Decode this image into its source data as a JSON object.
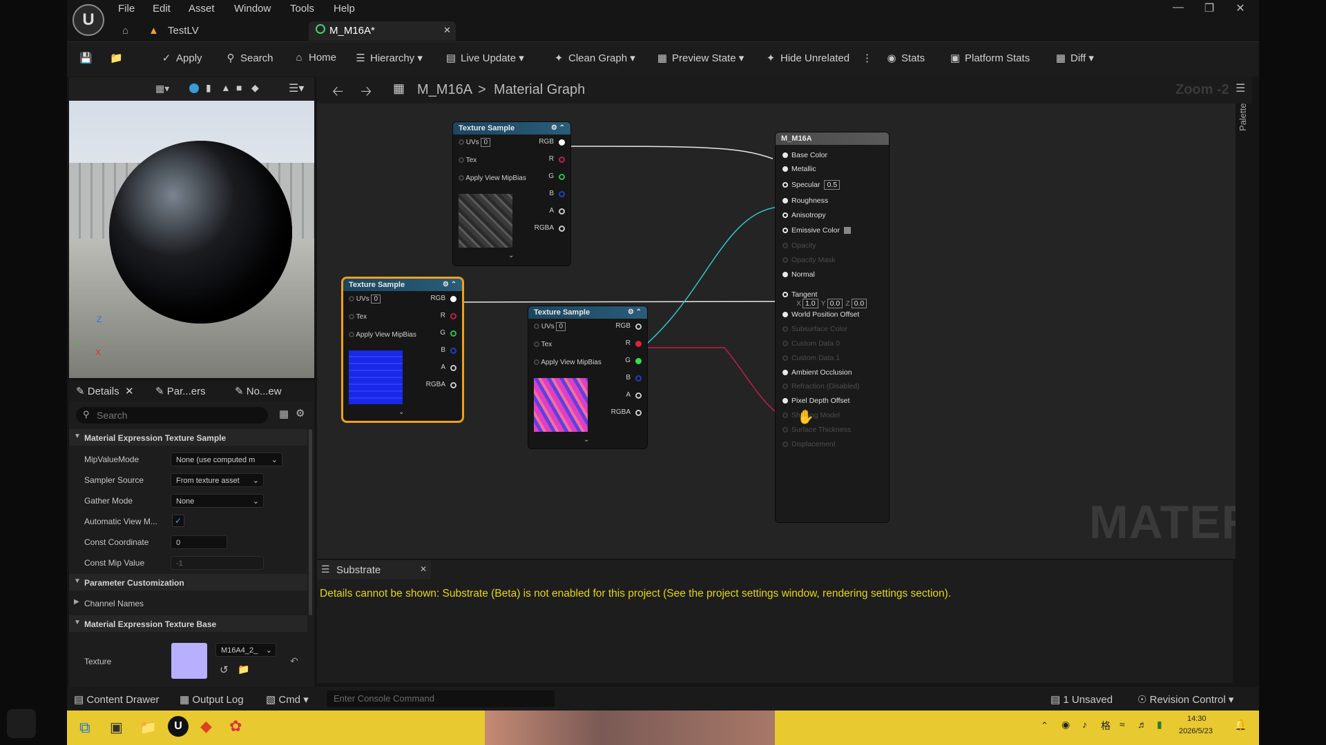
{
  "menu": [
    "File",
    "Edit",
    "Asset",
    "Window",
    "Tools",
    "Help"
  ],
  "tabs": {
    "level": "TestLV",
    "asset": "M_M16A*"
  },
  "toolbar": {
    "apply": "Apply",
    "search": "Search",
    "home": "Home",
    "hierarchy": "Hierarchy",
    "live_update": "Live Update",
    "clean_graph": "Clean Graph",
    "preview_state": "Preview State",
    "hide_unrelated": "Hide Unrelated",
    "stats": "Stats",
    "platform_stats": "Platform Stats",
    "diff": "Diff"
  },
  "breadcrumb": {
    "asset": "M_M16A",
    "sep": ">",
    "graph": "Material Graph",
    "zoom": "Zoom -2",
    "palette": "Palette"
  },
  "details_tabs": {
    "details": "Details",
    "params": "Par...ers",
    "preview": "No...ew"
  },
  "details": {
    "search_placeholder": "Search",
    "cat1": "Material Expression Texture Sample",
    "mip_label": "MipValueMode",
    "mip_value": "None (use computed m",
    "sampler_label": "Sampler Source",
    "sampler_value": "From texture asset",
    "gather_label": "Gather Mode",
    "gather_value": "None",
    "auto_label": "Automatic View M...",
    "const_coord_label": "Const Coordinate",
    "const_coord_value": "0",
    "const_mip_label": "Const Mip Value",
    "const_mip_value": "-1",
    "cat2": "Parameter Customization",
    "channel_names": "Channel Names",
    "cat3": "Material Expression Texture Base",
    "texture_label": "Texture",
    "texture_value": "M16A4_2_"
  },
  "nodes": {
    "title": "Texture Sample",
    "uvs": "UVs",
    "uv_index": "0",
    "tex": "Tex",
    "apply_mip": "Apply View MipBias",
    "out": [
      "RGB",
      "R",
      "G",
      "B",
      "A",
      "RGBA"
    ]
  },
  "material_node": {
    "title": "M_M16A",
    "specular_value": "0.5",
    "tangent": {
      "x": "1.0",
      "y": "0.0",
      "z": "0.0"
    },
    "pins": [
      {
        "label": "Base Color",
        "enabled": true
      },
      {
        "label": "Metallic",
        "enabled": true
      },
      {
        "label": "Specular",
        "enabled": true
      },
      {
        "label": "Roughness",
        "enabled": true
      },
      {
        "label": "Anisotropy",
        "enabled": true
      },
      {
        "label": "Emissive Color",
        "enabled": true
      },
      {
        "label": "Opacity",
        "enabled": false
      },
      {
        "label": "Opacity Mask",
        "enabled": false
      },
      {
        "label": "Normal",
        "enabled": true
      },
      {
        "label": "Tangent",
        "enabled": true
      },
      {
        "label": "World Position Offset",
        "enabled": true
      },
      {
        "label": "Subsurface Color",
        "enabled": false
      },
      {
        "label": "Custom Data 0",
        "enabled": false
      },
      {
        "label": "Custom Data 1",
        "enabled": false
      },
      {
        "label": "Ambient Occlusion",
        "enabled": true
      },
      {
        "label": "Refraction (Disabled)",
        "enabled": false
      },
      {
        "label": "Pixel Depth Offset",
        "enabled": true
      },
      {
        "label": "Shading Model",
        "enabled": false
      },
      {
        "label": "Surface Thickness",
        "enabled": false
      },
      {
        "label": "Displacement",
        "enabled": false
      }
    ]
  },
  "watermark": "MATERIAL",
  "substrate": {
    "tab": "Substrate",
    "message": "Details cannot be shown: Substrate (Beta) is not enabled for this project (See the project settings window, rendering settings section)."
  },
  "statusbar": {
    "content_drawer": "Content Drawer",
    "output_log": "Output Log",
    "cmd": "Cmd",
    "console_placeholder": "Enter Console Command",
    "unsaved": "1 Unsaved",
    "revision": "Revision Control"
  },
  "taskbar": {
    "time": "14:30",
    "date": "2026/5/23"
  },
  "colors": {
    "accent_orange": "#f0a020",
    "text_yellow": "#e6d61a",
    "node_header": "#2a5c78"
  }
}
